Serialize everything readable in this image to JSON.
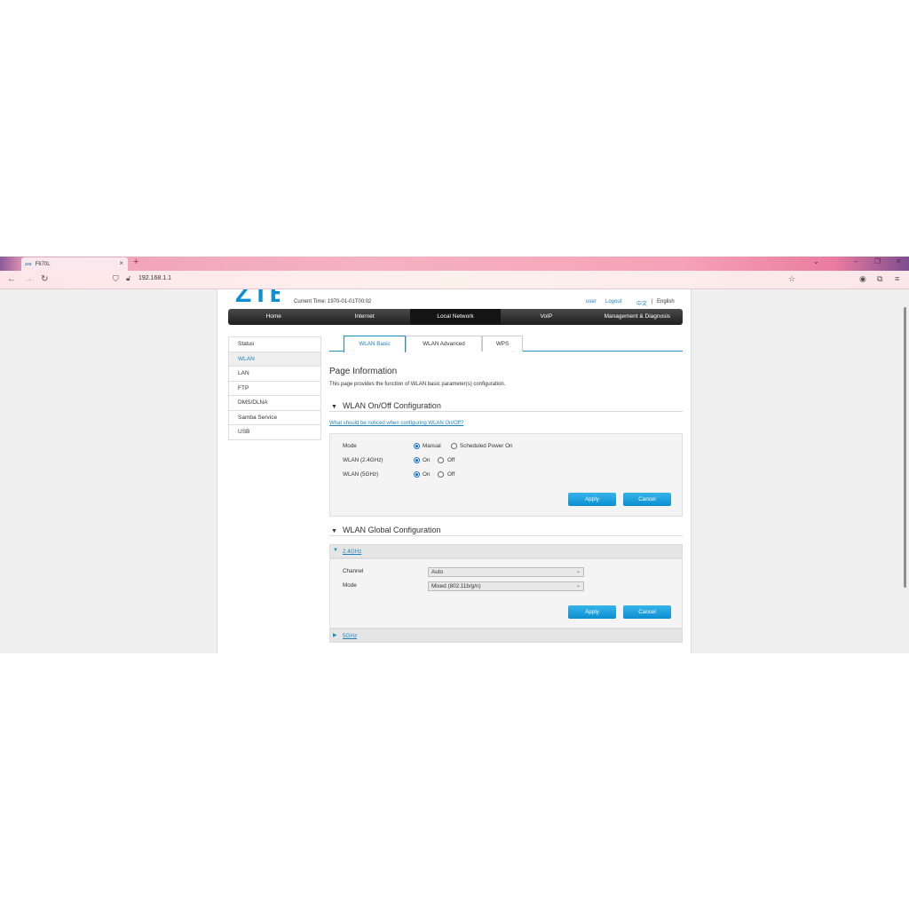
{
  "browser": {
    "tab_title": "F670L",
    "tab_favicon": "ZTE",
    "url": "192.168.1.1"
  },
  "header": {
    "logo": "ZTE",
    "current_time": "Current Time: 1970-01-01T00:02",
    "user": "user",
    "logout": "Logout",
    "lang_zh": "中文",
    "lang_sep": "|",
    "lang_en": "English"
  },
  "main_nav": [
    "Home",
    "Internet",
    "Local Network",
    "VoIP",
    "Management & Diagnosis"
  ],
  "sidebar": [
    "Status",
    "WLAN",
    "LAN",
    "FTP",
    "DMS/DLNA",
    "Samba Service",
    "USB"
  ],
  "sub_tabs": [
    "WLAN Basic",
    "WLAN Advanced",
    "WPS"
  ],
  "page_info": {
    "title": "Page Information",
    "text": "This page provides the function of WLAN basic parameter(s) configuration."
  },
  "onoff": {
    "title": "WLAN On/Off Configuration",
    "help_link": "What should be noticed when configuring WLAN On/Off?",
    "mode_label": "Mode",
    "mode_manual": "Manual",
    "mode_sched": "Scheduled Power On",
    "wlan24_label": "WLAN (2.4GHz)",
    "wlan5_label": "WLAN (5GHz)",
    "on": "On",
    "off": "Off",
    "apply": "Apply",
    "cancel": "Cancel"
  },
  "global": {
    "title": "WLAN Global Configuration",
    "band24": "2.4GHz",
    "channel_label": "Channel",
    "channel_value": "Auto",
    "mode_label": "Mode",
    "mode_value": "Mixed (802.11b/g/n)",
    "apply": "Apply",
    "cancel": "Cancel",
    "band5": "5GHz"
  },
  "colors": {
    "accent": "#1e7fc0",
    "button": "#1a9ee0",
    "nav_bg": "#2a2a2a"
  }
}
